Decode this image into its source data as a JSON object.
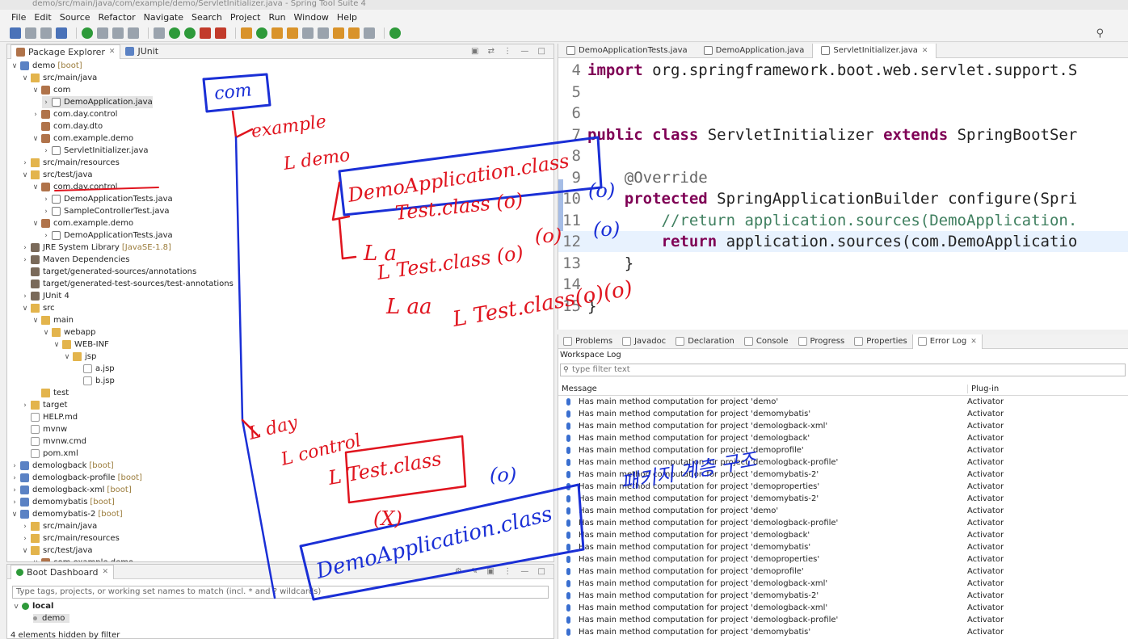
{
  "window": {
    "title": "demo/src/main/java/com/example/demo/ServletInitializer.java - Spring Tool Suite 4"
  },
  "menu": [
    "File",
    "Edit",
    "Source",
    "Refactor",
    "Navigate",
    "Search",
    "Project",
    "Run",
    "Window",
    "Help"
  ],
  "explorer": {
    "tabs": [
      {
        "label": "Package Explorer"
      },
      {
        "label": "JUnit"
      }
    ],
    "rows": [
      {
        "depth": 0,
        "twist": "v",
        "icon": "proj",
        "label": "demo",
        "tag": "[boot]"
      },
      {
        "depth": 1,
        "twist": "v",
        "icon": "folder",
        "label": "src/main/java"
      },
      {
        "depth": 2,
        "twist": "v",
        "icon": "pkg",
        "label": "com"
      },
      {
        "depth": 3,
        "twist": ">",
        "icon": "java",
        "label": "DemoApplication.java",
        "selected": true
      },
      {
        "depth": 2,
        "twist": ">",
        "icon": "pkg",
        "label": "com.day.control"
      },
      {
        "depth": 2,
        "twist": "",
        "icon": "pkg",
        "label": "com.day.dto"
      },
      {
        "depth": 2,
        "twist": "v",
        "icon": "pkg",
        "label": "com.example.demo"
      },
      {
        "depth": 3,
        "twist": ">",
        "icon": "java",
        "label": "ServletInitializer.java"
      },
      {
        "depth": 1,
        "twist": ">",
        "icon": "folder",
        "label": "src/main/resources"
      },
      {
        "depth": 1,
        "twist": "v",
        "icon": "folder",
        "label": "src/test/java"
      },
      {
        "depth": 2,
        "twist": "v",
        "icon": "pkg",
        "label": "com.day.control"
      },
      {
        "depth": 3,
        "twist": ">",
        "icon": "java",
        "label": "DemoApplicationTests.java"
      },
      {
        "depth": 3,
        "twist": ">",
        "icon": "java",
        "label": "SampleControllerTest.java"
      },
      {
        "depth": 2,
        "twist": "v",
        "icon": "pkg",
        "label": "com.example.demo"
      },
      {
        "depth": 3,
        "twist": ">",
        "icon": "java",
        "label": "DemoApplicationTests.java"
      },
      {
        "depth": 1,
        "twist": ">",
        "icon": "lib",
        "label": "JRE System Library",
        "tag": "[JavaSE-1.8]"
      },
      {
        "depth": 1,
        "twist": ">",
        "icon": "lib",
        "label": "Maven Dependencies"
      },
      {
        "depth": 1,
        "twist": "",
        "icon": "lib",
        "label": "target/generated-sources/annotations"
      },
      {
        "depth": 1,
        "twist": "",
        "icon": "lib",
        "label": "target/generated-test-sources/test-annotations"
      },
      {
        "depth": 1,
        "twist": ">",
        "icon": "lib",
        "label": "JUnit 4"
      },
      {
        "depth": 1,
        "twist": "v",
        "icon": "folder",
        "label": "src"
      },
      {
        "depth": 2,
        "twist": "v",
        "icon": "folder",
        "label": "main"
      },
      {
        "depth": 3,
        "twist": "v",
        "icon": "folder",
        "label": "webapp"
      },
      {
        "depth": 4,
        "twist": "v",
        "icon": "folder",
        "label": "WEB-INF"
      },
      {
        "depth": 5,
        "twist": "v",
        "icon": "folder",
        "label": "jsp"
      },
      {
        "depth": 6,
        "twist": "",
        "icon": "file",
        "label": "a.jsp"
      },
      {
        "depth": 6,
        "twist": "",
        "icon": "file",
        "label": "b.jsp"
      },
      {
        "depth": 2,
        "twist": "",
        "icon": "folder",
        "label": "test"
      },
      {
        "depth": 1,
        "twist": ">",
        "icon": "folder",
        "label": "target"
      },
      {
        "depth": 1,
        "twist": "",
        "icon": "file",
        "label": "HELP.md"
      },
      {
        "depth": 1,
        "twist": "",
        "icon": "file",
        "label": "mvnw"
      },
      {
        "depth": 1,
        "twist": "",
        "icon": "file",
        "label": "mvnw.cmd"
      },
      {
        "depth": 1,
        "twist": "",
        "icon": "file",
        "label": "pom.xml"
      },
      {
        "depth": 0,
        "twist": ">",
        "icon": "proj",
        "label": "demologback",
        "tag": "[boot]"
      },
      {
        "depth": 0,
        "twist": ">",
        "icon": "proj",
        "label": "demologback-profile",
        "tag": "[boot]"
      },
      {
        "depth": 0,
        "twist": ">",
        "icon": "proj",
        "label": "demologback-xml",
        "tag": "[boot]"
      },
      {
        "depth": 0,
        "twist": ">",
        "icon": "proj",
        "label": "demomybatis",
        "tag": "[boot]"
      },
      {
        "depth": 0,
        "twist": "v",
        "icon": "proj",
        "label": "demomybatis-2",
        "tag": "[boot]"
      },
      {
        "depth": 1,
        "twist": ">",
        "icon": "folder",
        "label": "src/main/java"
      },
      {
        "depth": 1,
        "twist": ">",
        "icon": "folder",
        "label": "src/main/resources"
      },
      {
        "depth": 1,
        "twist": "v",
        "icon": "folder",
        "label": "src/test/java"
      },
      {
        "depth": 2,
        "twist": "v",
        "icon": "pkg",
        "label": "com.example.demo"
      }
    ]
  },
  "editor": {
    "tabs": [
      {
        "label": "DemoApplicationTests.java",
        "active": false
      },
      {
        "label": "DemoApplication.java",
        "active": false
      },
      {
        "label": "ServletInitializer.java",
        "active": true
      }
    ],
    "lines": [
      {
        "n": "4",
        "parts": [
          {
            "t": "import",
            "c": "kw"
          },
          {
            "t": " org.springframework.boot.web.servlet.support.S",
            "c": ""
          }
        ]
      },
      {
        "n": "5",
        "parts": []
      },
      {
        "n": "6",
        "parts": []
      },
      {
        "n": "7",
        "parts": [
          {
            "t": "public",
            "c": "kw"
          },
          {
            "t": " ",
            "c": ""
          },
          {
            "t": "class",
            "c": "kw"
          },
          {
            "t": " ServletInitializer ",
            "c": ""
          },
          {
            "t": "extends",
            "c": "kw"
          },
          {
            "t": " SpringBootSer",
            "c": ""
          }
        ]
      },
      {
        "n": "8",
        "parts": []
      },
      {
        "n": "9",
        "parts": [
          {
            "t": "    @Override",
            "c": "ann"
          }
        ]
      },
      {
        "n": "10",
        "parts": [
          {
            "t": "    ",
            "c": ""
          },
          {
            "t": "protected",
            "c": "kw"
          },
          {
            "t": " SpringApplicationBuilder configure(Spri",
            "c": ""
          }
        ]
      },
      {
        "n": "11",
        "parts": [
          {
            "t": "        //return application.sources(DemoApplication.",
            "c": "cmt"
          }
        ]
      },
      {
        "n": "12",
        "parts": [
          {
            "t": "        ",
            "c": ""
          },
          {
            "t": "return",
            "c": "kw"
          },
          {
            "t": " application.sources(com.DemoApplicatio",
            "c": ""
          }
        ],
        "highlight": true
      },
      {
        "n": "13",
        "parts": [
          {
            "t": "    }",
            "c": ""
          }
        ]
      },
      {
        "n": "14",
        "parts": []
      },
      {
        "n": "15",
        "parts": [
          {
            "t": "}",
            "c": ""
          }
        ]
      }
    ]
  },
  "bottom": {
    "tabs": [
      "Problems",
      "Javadoc",
      "Declaration",
      "Console",
      "Progress",
      "Properties",
      "Error Log"
    ],
    "active_tab": "Error Log",
    "workspace_log": "Workspace Log",
    "filter_placeholder": "type filter text",
    "columns": [
      "Message",
      "Plug-in"
    ],
    "rows": [
      {
        "msg": "Has main method computation for project 'demo'",
        "plugin": "Activator"
      },
      {
        "msg": "Has main method computation for project 'demomybatis'",
        "plugin": "Activator"
      },
      {
        "msg": "Has main method computation for project 'demologback-xml'",
        "plugin": "Activator"
      },
      {
        "msg": "Has main method computation for project 'demologback'",
        "plugin": "Activator"
      },
      {
        "msg": "Has main method computation for project 'demoprofile'",
        "plugin": "Activator"
      },
      {
        "msg": "Has main method computation for project 'demologback-profile'",
        "plugin": "Activator"
      },
      {
        "msg": "Has main method computation for project 'demomybatis-2'",
        "plugin": "Activator"
      },
      {
        "msg": "Has main method computation for project 'demoproperties'",
        "plugin": "Activator"
      },
      {
        "msg": "Has main method computation for project 'demomybatis-2'",
        "plugin": "Activator"
      },
      {
        "msg": "Has main method computation for project 'demo'",
        "plugin": "Activator"
      },
      {
        "msg": "Has main method computation for project 'demologback-profile'",
        "plugin": "Activator"
      },
      {
        "msg": "Has main method computation for project 'demologback'",
        "plugin": "Activator"
      },
      {
        "msg": "Has main method computation for project 'demomybatis'",
        "plugin": "Activator"
      },
      {
        "msg": "Has main method computation for project 'demoproperties'",
        "plugin": "Activator"
      },
      {
        "msg": "Has main method computation for project 'demoprofile'",
        "plugin": "Activator"
      },
      {
        "msg": "Has main method computation for project 'demologback-xml'",
        "plugin": "Activator"
      },
      {
        "msg": "Has main method computation for project 'demomybatis-2'",
        "plugin": "Activator"
      },
      {
        "msg": "Has main method computation for project 'demologback-xml'",
        "plugin": "Activator"
      },
      {
        "msg": "Has main method computation for project 'demologback-profile'",
        "plugin": "Activator"
      },
      {
        "msg": "Has main method computation for project 'demomybatis'",
        "plugin": "Activator"
      }
    ]
  },
  "dashboard": {
    "title": "Boot Dashboard",
    "filter_placeholder": "Type tags, projects, or working set names to match (incl. * and ? wildcards)",
    "group": "local",
    "app": "demo",
    "hidden": "4 elements hidden by filter"
  },
  "annotations": {
    "com": "com",
    "example": "example",
    "demo": "L demo",
    "demoapp": "DemoApplication.class",
    "test1": "Test.class (o)",
    "o1": "(o)",
    "a": "L a",
    "test2": "L Test.class (o)",
    "o2": "(o)",
    "aa": "L aa",
    "test3": "L Test.class(o)(o)",
    "day": "L day",
    "control": "L control",
    "test4": "L Test.class",
    "x": "(X)",
    "o3": "(o)",
    "demoapp2": "DemoApplication.class",
    "korean": "패키지 계층 구조"
  }
}
